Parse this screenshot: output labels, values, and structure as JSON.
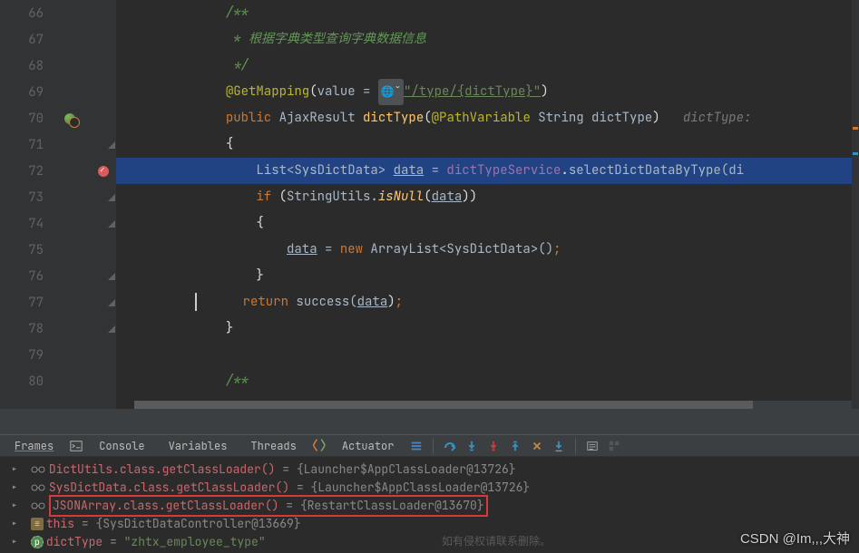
{
  "editor": {
    "lines": [
      {
        "num": 66,
        "indent": 12,
        "segments": [
          {
            "cls": "comment",
            "text": "/**"
          }
        ]
      },
      {
        "num": 67,
        "indent": 12,
        "segments": [
          {
            "cls": "comment",
            "text": " * 根据字典类型查询字典数据信息"
          }
        ]
      },
      {
        "num": 68,
        "indent": 12,
        "segments": [
          {
            "cls": "comment",
            "text": " */"
          }
        ]
      },
      {
        "num": 69,
        "indent": 12,
        "segments": [
          {
            "cls": "annotation",
            "text": "@GetMapping"
          },
          {
            "cls": "white",
            "text": "("
          },
          {
            "cls": "type",
            "text": "value = "
          },
          {
            "cls": "globe",
            "text": "🌐ˇ"
          },
          {
            "cls": "str-u",
            "text": "\"/type/{dictType}\""
          },
          {
            "cls": "white",
            "text": ")"
          }
        ]
      },
      {
        "num": 70,
        "indent": 12,
        "segments": [
          {
            "cls": "keyword",
            "text": "public "
          },
          {
            "cls": "type",
            "text": "AjaxResult "
          },
          {
            "cls": "method",
            "text": "dictType"
          },
          {
            "cls": "white",
            "text": "("
          },
          {
            "cls": "annotation",
            "text": "@PathVariable"
          },
          {
            "cls": "type",
            "text": " String dictType"
          },
          {
            "cls": "white",
            "text": ")   "
          },
          {
            "cls": "hint",
            "text": "dictType:"
          }
        ]
      },
      {
        "num": 71,
        "indent": 12,
        "segments": [
          {
            "cls": "white",
            "text": "{"
          }
        ]
      },
      {
        "num": 72,
        "indent": 16,
        "hl": true,
        "segments": [
          {
            "cls": "type",
            "text": "List<SysDictData> "
          },
          {
            "cls": "localvar",
            "text": "data"
          },
          {
            "cls": "type",
            "text": " = "
          },
          {
            "cls": "field",
            "text": "dictTypeService"
          },
          {
            "cls": "white",
            "text": "."
          },
          {
            "cls": "type",
            "text": "selectDictDataByType(di"
          }
        ]
      },
      {
        "num": 73,
        "indent": 16,
        "segments": [
          {
            "cls": "keyword",
            "text": "if "
          },
          {
            "cls": "white",
            "text": "("
          },
          {
            "cls": "type",
            "text": "StringUtils."
          },
          {
            "cls": "method-i",
            "text": "isNull"
          },
          {
            "cls": "white",
            "text": "("
          },
          {
            "cls": "localvar",
            "text": "data"
          },
          {
            "cls": "white",
            "text": "))"
          }
        ]
      },
      {
        "num": 74,
        "indent": 16,
        "segments": [
          {
            "cls": "white",
            "text": "{"
          }
        ]
      },
      {
        "num": 75,
        "indent": 20,
        "segments": [
          {
            "cls": "localvar",
            "text": "data"
          },
          {
            "cls": "type",
            "text": " = "
          },
          {
            "cls": "keyword",
            "text": "new "
          },
          {
            "cls": "type",
            "text": "ArrayList<SysDictData>()"
          },
          {
            "cls": "keyword",
            "text": ";"
          }
        ]
      },
      {
        "num": 76,
        "indent": 16,
        "segments": [
          {
            "cls": "white",
            "text": "}"
          }
        ]
      },
      {
        "num": 77,
        "indent": 16,
        "caret": true,
        "segments": [
          {
            "cls": "keyword",
            "text": "return "
          },
          {
            "cls": "type",
            "text": "success("
          },
          {
            "cls": "localvar",
            "text": "data"
          },
          {
            "cls": "white",
            "text": ")"
          },
          {
            "cls": "keyword",
            "text": ";"
          }
        ]
      },
      {
        "num": 78,
        "indent": 12,
        "segments": [
          {
            "cls": "white",
            "text": "}"
          }
        ]
      },
      {
        "num": 79,
        "indent": 0,
        "segments": []
      },
      {
        "num": 80,
        "indent": 12,
        "segments": [
          {
            "cls": "comment",
            "text": "/**"
          }
        ]
      }
    ]
  },
  "debugger": {
    "tabs": {
      "frames": "Frames",
      "console": "Console",
      "variables": "Variables",
      "threads": "Threads",
      "actuator": "Actuator"
    }
  },
  "variables": {
    "rows": [
      {
        "expand": true,
        "icon": "glasses",
        "name": "DictUtils.class.getClassLoader()",
        "eq": " = ",
        "val": "{Launcher$AppClassLoader@13726}"
      },
      {
        "expand": true,
        "icon": "glasses",
        "name": "SysDictData.class.getClassLoader()",
        "eq": " = ",
        "val": "{Launcher$AppClassLoader@13726}"
      },
      {
        "expand": true,
        "icon": "glasses",
        "boxed": true,
        "name": "JSONArray.class.getClassLoader()",
        "eq": " = ",
        "val": "{RestartClassLoader@13670}"
      },
      {
        "expand": true,
        "icon": "hash",
        "name": "this",
        "eq": " = ",
        "val": "{SysDictDataController@13669}"
      },
      {
        "expand": true,
        "icon": "p",
        "name": "dictType",
        "eq": " = ",
        "strval": "\"zhtx_employee_type\""
      }
    ]
  },
  "watermark": "CSDN @Im,,,大神",
  "watermark_sub": "如有侵权请联系删除。"
}
